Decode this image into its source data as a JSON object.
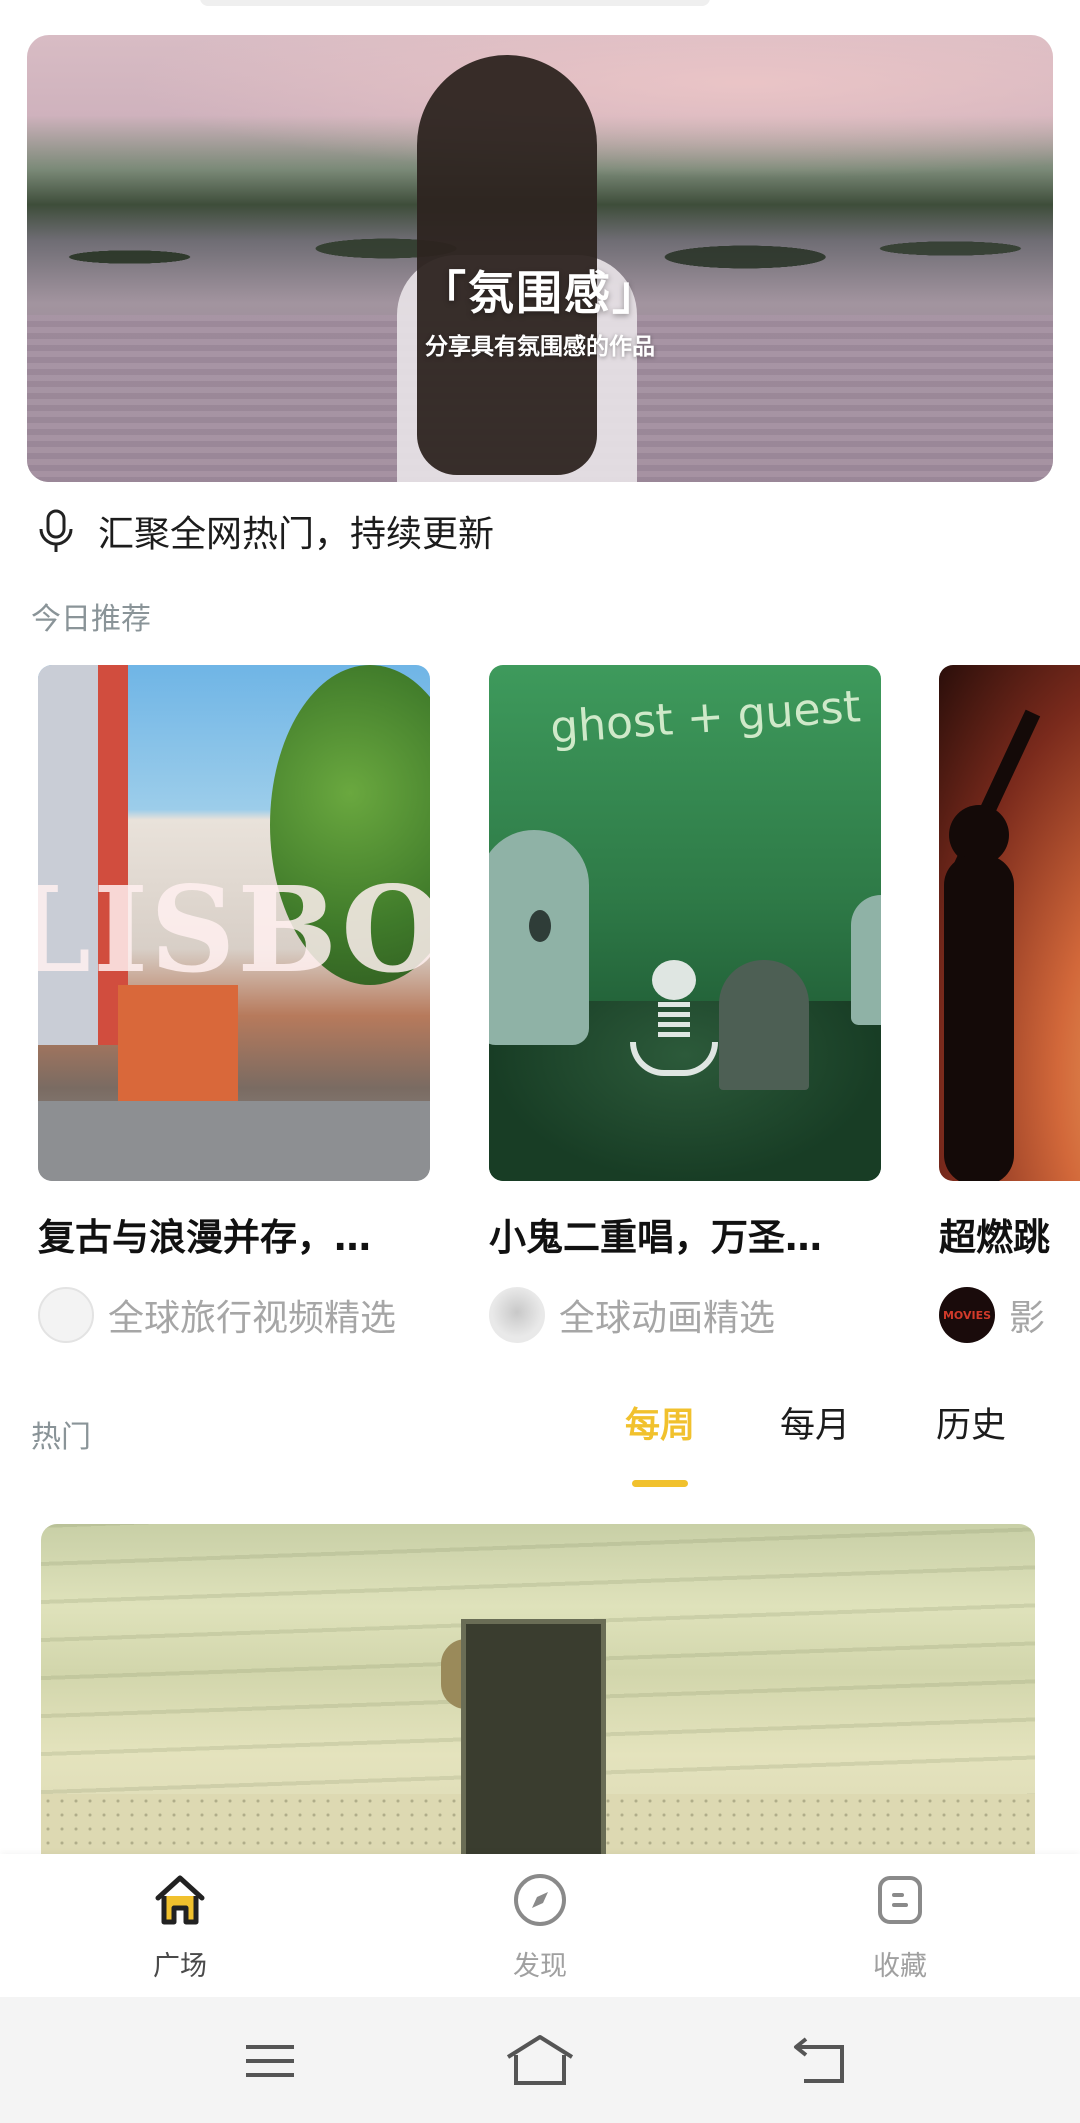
{
  "banner": {
    "title": "「氛围感」",
    "subtitle": "分享具有氛围感的作品"
  },
  "notice": {
    "text": "汇聚全网热门，持续更新",
    "icon": "microphone-icon"
  },
  "recommend": {
    "label": "今日推荐",
    "items": [
      {
        "title": "复古与浪漫并存，…",
        "author": "全球旅行视频精选",
        "thumb_text": "LISBON"
      },
      {
        "title": "小鬼二重唱，万圣…",
        "author": "全球动画精选",
        "thumb_text": "ghost + guest"
      },
      {
        "title": "超燃跳",
        "author": "影",
        "avatar_text": "MOVIES"
      }
    ]
  },
  "hot": {
    "label": "热门",
    "tabs": [
      {
        "label": "每周",
        "active": true
      },
      {
        "label": "每月",
        "active": false
      },
      {
        "label": "历史",
        "active": false
      }
    ]
  },
  "bottom_nav": {
    "items": [
      {
        "label": "广场",
        "icon": "home-icon",
        "active": true
      },
      {
        "label": "发现",
        "icon": "compass-icon",
        "active": false
      },
      {
        "label": "收藏",
        "icon": "bookmark-icon",
        "active": false
      }
    ]
  },
  "system_nav": {
    "buttons": [
      "menu-icon",
      "home-outline-icon",
      "back-icon"
    ]
  },
  "colors": {
    "accent": "#f1c12d",
    "label_gray": "#8a9498",
    "author_gray": "#a6a6a6"
  }
}
